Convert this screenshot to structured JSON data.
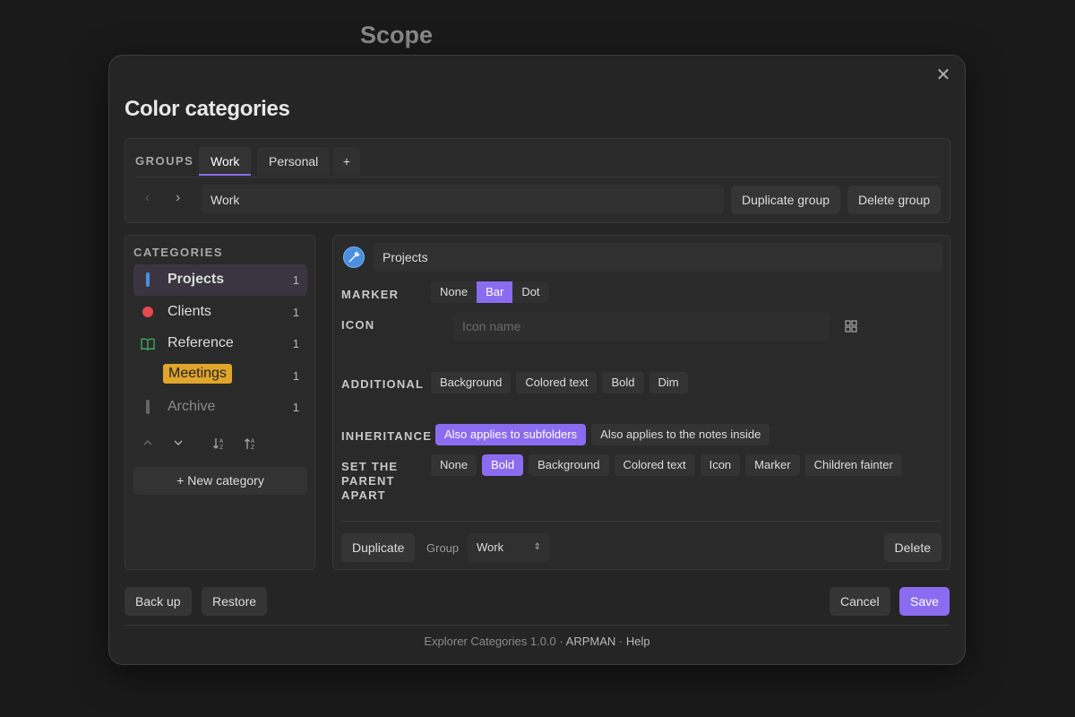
{
  "background": {
    "title": "Scope"
  },
  "modal": {
    "title": "Color categories",
    "close_icon": "close-icon"
  },
  "groups": {
    "label": "GROUPS",
    "tabs": [
      {
        "label": "Work",
        "active": true
      },
      {
        "label": "Personal",
        "active": false
      }
    ],
    "add_tab_label": "+",
    "prev_icon": "chevron-left-icon",
    "next_icon": "chevron-right-icon",
    "name_value": "Work",
    "duplicate_label": "Duplicate group",
    "delete_label": "Delete group"
  },
  "categories": {
    "label": "CATEGORIES",
    "items": [
      {
        "name": "Projects",
        "count": "1",
        "marker": "bar",
        "color": "#4a8fe0"
      },
      {
        "name": "Clients",
        "count": "1",
        "marker": "dot",
        "color": "#e84848"
      },
      {
        "name": "Reference",
        "count": "1",
        "marker": "book-icon",
        "color": "#3cb35e"
      },
      {
        "name": "Meetings",
        "count": "1",
        "marker": "background",
        "color": "#e0a52b"
      },
      {
        "name": "Archive",
        "count": "1",
        "marker": "bar",
        "color": "#666666"
      }
    ],
    "new_category_label": "+ New category",
    "tool_icons": [
      "chevron-up-icon",
      "chevron-down-icon",
      "sort-ascending-icon",
      "sort-descending-icon"
    ]
  },
  "detail": {
    "color_icon": "pipette-icon",
    "name_value": "Projects",
    "marker": {
      "label": "MARKER",
      "options": [
        "None",
        "Bar",
        "Dot"
      ],
      "selected": "Bar"
    },
    "icon": {
      "label": "ICON",
      "placeholder": "Icon name",
      "picker_icon": "grid-icon"
    },
    "additional": {
      "label": "ADDITIONAL",
      "options": [
        "Background",
        "Colored text",
        "Bold",
        "Dim"
      ]
    },
    "inheritance": {
      "label": "INHERITANCE",
      "options": [
        "Also applies to subfolders",
        "Also applies to the notes inside"
      ],
      "selected": "Also applies to subfolders"
    },
    "parent_apart": {
      "label": "SET THE PARENT APART",
      "options": [
        "None",
        "Bold",
        "Background",
        "Colored text",
        "Icon",
        "Marker",
        "Children fainter"
      ],
      "selected": "Bold"
    },
    "duplicate_label": "Duplicate",
    "group_label": "Group",
    "group_value": "Work",
    "delete_label": "Delete"
  },
  "actions": {
    "backup_label": "Back up",
    "restore_label": "Restore",
    "cancel_label": "Cancel",
    "save_label": "Save"
  },
  "footer": {
    "version": "Explorer Categories 1.0.0",
    "separator": "·",
    "author": "ARPMAN",
    "help": "Help"
  },
  "colors": {
    "accent": "#8b6cf0",
    "background": "#1a1a1a",
    "modal": "#252525"
  }
}
